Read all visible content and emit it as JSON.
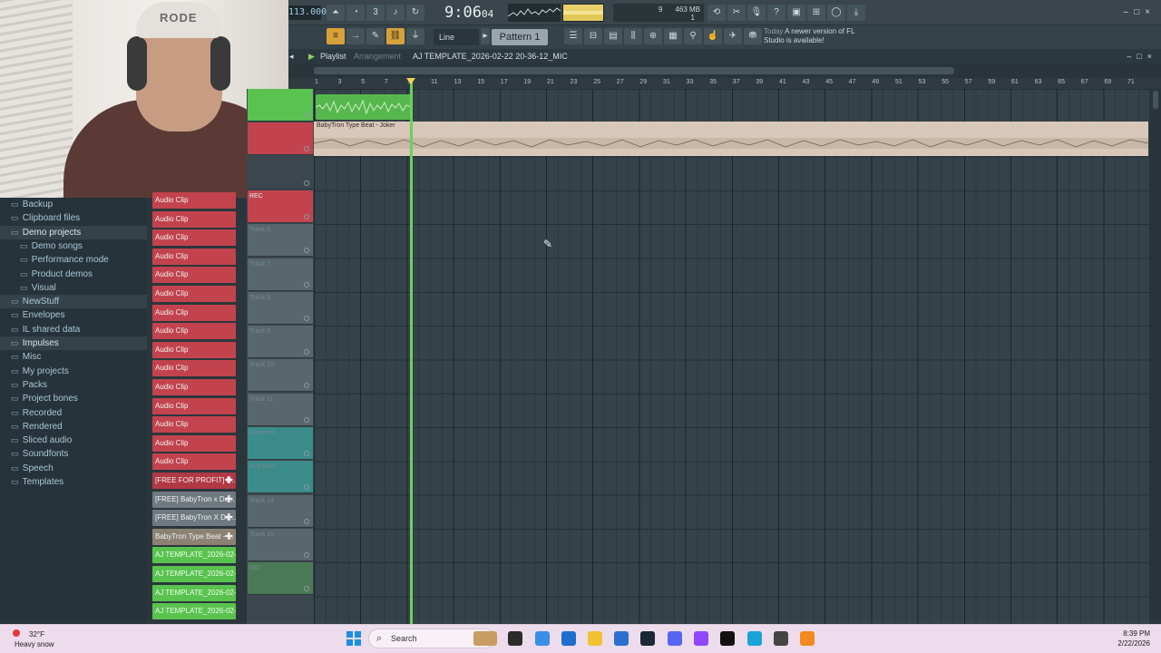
{
  "toolbar": {
    "tempo": "113.000",
    "clock_main": "9:06",
    "clock_sub": "04",
    "cpu_mem": "463 MB",
    "cpu_poly": "9",
    "cpu_poly2": "1",
    "snap_mode": "Line",
    "pattern": "Pattern 1",
    "news_title": "Today",
    "news_text": "A newer version of FL Studio is available!"
  },
  "playlist": {
    "title": "Playlist",
    "arrangement": "Arrangement",
    "project": "AJ TEMPLATE_2026-02-22 20-36-12_MIC",
    "ruler": [
      "1",
      "3",
      "5",
      "7",
      "9",
      "11",
      "13",
      "15",
      "17",
      "19",
      "21",
      "23",
      "25",
      "27",
      "29",
      "31",
      "33",
      "35",
      "37",
      "39",
      "41",
      "43",
      "45",
      "47",
      "49",
      "51",
      "53",
      "55",
      "57",
      "59",
      "61",
      "63",
      "65",
      "67",
      "69",
      "71"
    ],
    "audio_clip_label": "BabyTron Type Beat - Joker",
    "track_labels": [
      "",
      "",
      "",
      "REC",
      "Track 6",
      "Track 7",
      "Track 8",
      "Track 9",
      "Track 10",
      "Track 11",
      "AI preset",
      "AI preset",
      "Track 14",
      "Track 15",
      "MIC"
    ]
  },
  "browser": {
    "items": [
      {
        "label": "Backup",
        "level": 0
      },
      {
        "label": "Clipboard files",
        "level": 0
      },
      {
        "label": "Demo projects",
        "level": 0
      },
      {
        "label": "Demo songs",
        "level": 1
      },
      {
        "label": "Performance mode",
        "level": 1
      },
      {
        "label": "Product demos",
        "level": 1
      },
      {
        "label": "Visual",
        "level": 1
      },
      {
        "label": "NewStuff",
        "level": 0
      },
      {
        "label": "Envelopes",
        "level": 0
      },
      {
        "label": "IL shared data",
        "level": 0
      },
      {
        "label": "Impulses",
        "level": 0
      },
      {
        "label": "Misc",
        "level": 0
      },
      {
        "label": "My projects",
        "level": 0
      },
      {
        "label": "Packs",
        "level": 0
      },
      {
        "label": "Project bones",
        "level": 0
      },
      {
        "label": "Recorded",
        "level": 0
      },
      {
        "label": "Rendered",
        "level": 0
      },
      {
        "label": "Sliced audio",
        "level": 0
      },
      {
        "label": "Soundfonts",
        "level": 0
      },
      {
        "label": "Speech",
        "level": 0
      },
      {
        "label": "Templates",
        "level": 0
      }
    ]
  },
  "picker": {
    "clips": [
      {
        "label": "Audio Clip",
        "color": "red"
      },
      {
        "label": "Audio Clip",
        "color": "red"
      },
      {
        "label": "Audio Clip",
        "color": "red"
      },
      {
        "label": "Audio Clip",
        "color": "red"
      },
      {
        "label": "Audio Clip",
        "color": "red"
      },
      {
        "label": "Audio Clip",
        "color": "red"
      },
      {
        "label": "Audio Clip",
        "color": "red"
      },
      {
        "label": "Audio Clip",
        "color": "red"
      },
      {
        "label": "Audio Clip",
        "color": "red"
      },
      {
        "label": "Audio Clip",
        "color": "red"
      },
      {
        "label": "Audio Clip",
        "color": "red"
      },
      {
        "label": "Audio Clip",
        "color": "red"
      },
      {
        "label": "Audio Clip",
        "color": "red"
      },
      {
        "label": "Audio Clip",
        "color": "red"
      },
      {
        "label": "Audio Clip",
        "color": "red"
      },
      {
        "label": "[FREE FOR PROFIT] D...",
        "color": "red-d"
      },
      {
        "label": "[FREE] BabyTron x De...",
        "color": "gray"
      },
      {
        "label": "[FREE] BabyTron X De...",
        "color": "gray"
      },
      {
        "label": "BabyTron Type Beat - ...",
        "color": "sand"
      },
      {
        "label": "AJ TEMPLATE_2026-02-2...",
        "color": "green"
      },
      {
        "label": "AJ TEMPLATE_2026-02-2...",
        "color": "green"
      },
      {
        "label": "AJ TEMPLATE_2026-02-2...",
        "color": "green"
      },
      {
        "label": "AJ TEMPLATE_2026-02-2...",
        "color": "green"
      }
    ]
  },
  "webcam": {
    "hat_text": "RODE"
  },
  "taskbar": {
    "temperature": "32°F",
    "weather": "Heavy snow",
    "search": "Search",
    "time": "8:39 PM",
    "date": "2/22/2026"
  },
  "colors": {
    "accent_green": "#56b84c",
    "clip_red": "#c2434e",
    "playhead": "#6bd05a",
    "taskbar": "#eddcec"
  }
}
